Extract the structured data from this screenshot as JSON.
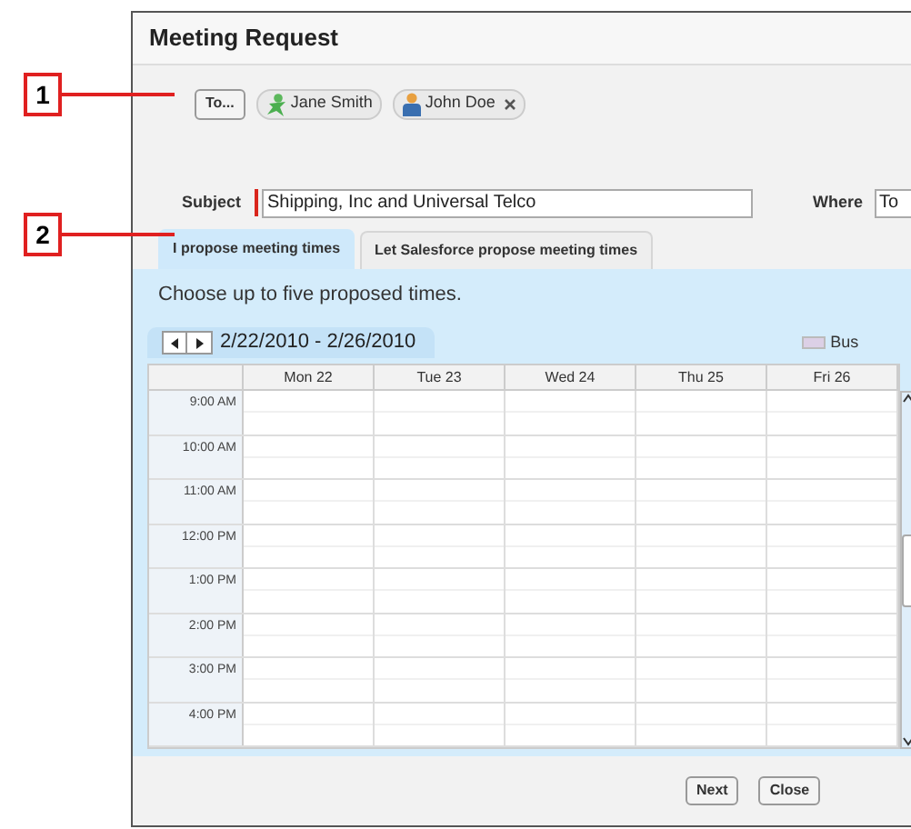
{
  "callouts": [
    {
      "label": "1"
    },
    {
      "label": "2"
    }
  ],
  "dialog": {
    "title": "Meeting Request"
  },
  "to_button": "To...",
  "recipients": [
    {
      "name": "Jane Smith",
      "kind": "contact",
      "removable": false
    },
    {
      "name": "John Doe",
      "kind": "user",
      "removable": true
    }
  ],
  "subject": {
    "label": "Subject",
    "value": "Shipping, Inc and Universal Telco",
    "required": true
  },
  "where": {
    "label": "Where",
    "value": "To"
  },
  "tabs": [
    {
      "label": "I propose meeting times",
      "selected": true
    },
    {
      "label": "Let Salesforce propose meeting times",
      "selected": false
    }
  ],
  "instructions": "Choose up to five proposed times.",
  "calendar": {
    "range": "2/22/2010 - 2/26/2010",
    "legend": "Bus",
    "columns": [
      "Mon 22",
      "Tue 23",
      "Wed 24",
      "Thu 25",
      "Fri 26"
    ],
    "rows": [
      "9:00 AM",
      "10:00 AM",
      "11:00 AM",
      "12:00 PM",
      "1:00 PM",
      "2:00 PM",
      "3:00 PM",
      "4:00 PM"
    ]
  },
  "buttons": [
    "Next",
    "Close"
  ]
}
